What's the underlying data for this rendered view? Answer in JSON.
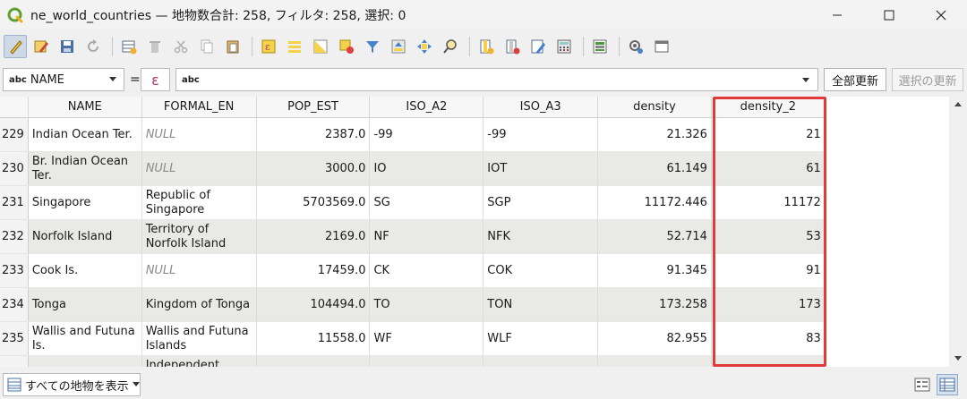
{
  "window": {
    "title": "ne_world_countries — 地物数合計: 258, フィルタ: 258, 選択: 0"
  },
  "expression_bar": {
    "field_type": "abc",
    "field_name": "NAME",
    "equals": "=",
    "epsilon": "ε",
    "expr_type": "abc",
    "update_all": "全部更新",
    "update_selected": "選択の更新"
  },
  "table": {
    "columns": [
      "NAME",
      "FORMAL_EN",
      "POP_EST",
      "ISO_A2",
      "ISO_A3",
      "density",
      "density_2"
    ],
    "rows": [
      {
        "num": "229",
        "name": "Indian Ocean Ter.",
        "formal": "NULL",
        "formal_null": true,
        "pop": "2387.0",
        "a2": "-99",
        "a3": "-99",
        "density": "21.326",
        "density2": "21"
      },
      {
        "num": "230",
        "name": "Br. Indian Ocean Ter.",
        "formal": "NULL",
        "formal_null": true,
        "pop": "3000.0",
        "a2": "IO",
        "a3": "IOT",
        "density": "61.149",
        "density2": "61"
      },
      {
        "num": "231",
        "name": "Singapore",
        "formal": "Republic of Singapore",
        "formal_null": false,
        "pop": "5703569.0",
        "a2": "SG",
        "a3": "SGP",
        "density": "11172.446",
        "density2": "11172"
      },
      {
        "num": "232",
        "name": "Norfolk Island",
        "formal": "Territory of Norfolk Island",
        "formal_null": false,
        "pop": "2169.0",
        "a2": "NF",
        "a3": "NFK",
        "density": "52.714",
        "density2": "53"
      },
      {
        "num": "233",
        "name": "Cook Is.",
        "formal": "NULL",
        "formal_null": true,
        "pop": "17459.0",
        "a2": "CK",
        "a3": "COK",
        "density": "91.345",
        "density2": "91"
      },
      {
        "num": "234",
        "name": "Tonga",
        "formal": "Kingdom of Tonga",
        "formal_null": false,
        "pop": "104494.0",
        "a2": "TO",
        "a3": "TON",
        "density": "173.258",
        "density2": "173"
      },
      {
        "num": "235",
        "name": "Wallis and Futuna Is.",
        "formal": "Wallis and Futuna Islands",
        "formal_null": false,
        "pop": "11558.0",
        "a2": "WF",
        "a3": "WLF",
        "density": "82.955",
        "density2": "83"
      },
      {
        "num": "",
        "name": "",
        "formal": "Independent State",
        "formal_null": false,
        "pop": "",
        "a2": "",
        "a3": "",
        "density": "",
        "density2": ""
      }
    ]
  },
  "statusbar": {
    "filter_label": "すべての地物を表示"
  },
  "colors": {
    "highlight": "#e03a3a",
    "alt_row": "#e9e9e6",
    "qgis_green": "#5fa130"
  }
}
